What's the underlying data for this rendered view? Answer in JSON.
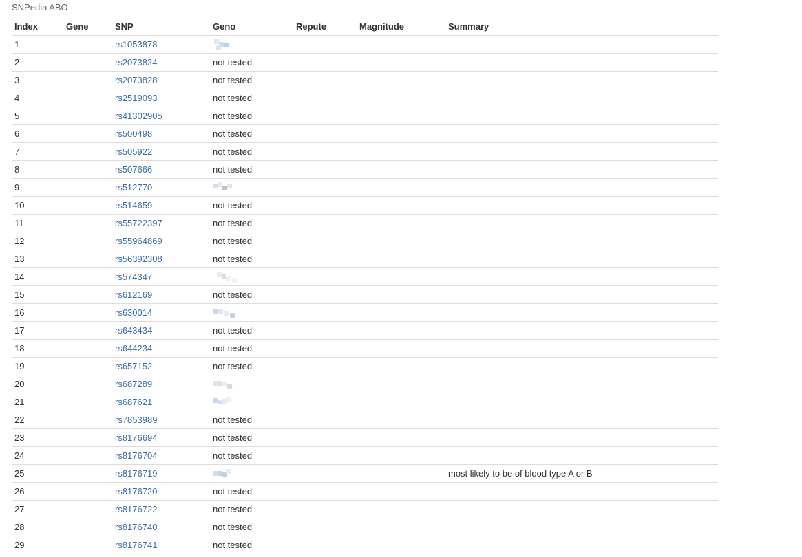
{
  "caption": "SNPedia ABO",
  "columns": [
    "Index",
    "Gene",
    "SNP",
    "Geno",
    "Repute",
    "Magnitude",
    "Summary"
  ],
  "rows": [
    {
      "index": "1",
      "gene": "",
      "snp": "rs1053878",
      "geno": "",
      "geno_blurred": true,
      "repute": "",
      "magnitude": "",
      "summary": ""
    },
    {
      "index": "2",
      "gene": "",
      "snp": "rs2073824",
      "geno": "not tested",
      "geno_blurred": false,
      "repute": "",
      "magnitude": "",
      "summary": ""
    },
    {
      "index": "3",
      "gene": "",
      "snp": "rs2073828",
      "geno": "not tested",
      "geno_blurred": false,
      "repute": "",
      "magnitude": "",
      "summary": ""
    },
    {
      "index": "4",
      "gene": "",
      "snp": "rs2519093",
      "geno": "not tested",
      "geno_blurred": false,
      "repute": "",
      "magnitude": "",
      "summary": ""
    },
    {
      "index": "5",
      "gene": "",
      "snp": "rs41302905",
      "geno": "not tested",
      "geno_blurred": false,
      "repute": "",
      "magnitude": "",
      "summary": ""
    },
    {
      "index": "6",
      "gene": "",
      "snp": "rs500498",
      "geno": "not tested",
      "geno_blurred": false,
      "repute": "",
      "magnitude": "",
      "summary": ""
    },
    {
      "index": "7",
      "gene": "",
      "snp": "rs505922",
      "geno": "not tested",
      "geno_blurred": false,
      "repute": "",
      "magnitude": "",
      "summary": ""
    },
    {
      "index": "8",
      "gene": "",
      "snp": "rs507666",
      "geno": "not tested",
      "geno_blurred": false,
      "repute": "",
      "magnitude": "",
      "summary": ""
    },
    {
      "index": "9",
      "gene": "",
      "snp": "rs512770",
      "geno": "",
      "geno_blurred": true,
      "repute": "",
      "magnitude": "",
      "summary": ""
    },
    {
      "index": "10",
      "gene": "",
      "snp": "rs514659",
      "geno": "not tested",
      "geno_blurred": false,
      "repute": "",
      "magnitude": "",
      "summary": ""
    },
    {
      "index": "11",
      "gene": "",
      "snp": "rs55722397",
      "geno": "not tested",
      "geno_blurred": false,
      "repute": "",
      "magnitude": "",
      "summary": ""
    },
    {
      "index": "12",
      "gene": "",
      "snp": "rs55964869",
      "geno": "not tested",
      "geno_blurred": false,
      "repute": "",
      "magnitude": "",
      "summary": ""
    },
    {
      "index": "13",
      "gene": "",
      "snp": "rs56392308",
      "geno": "not tested",
      "geno_blurred": false,
      "repute": "",
      "magnitude": "",
      "summary": ""
    },
    {
      "index": "14",
      "gene": "",
      "snp": "rs574347",
      "geno": "",
      "geno_blurred": true,
      "repute": "",
      "magnitude": "",
      "summary": ""
    },
    {
      "index": "15",
      "gene": "",
      "snp": "rs612169",
      "geno": "not tested",
      "geno_blurred": false,
      "repute": "",
      "magnitude": "",
      "summary": ""
    },
    {
      "index": "16",
      "gene": "",
      "snp": "rs630014",
      "geno": "",
      "geno_blurred": true,
      "repute": "",
      "magnitude": "",
      "summary": ""
    },
    {
      "index": "17",
      "gene": "",
      "snp": "rs643434",
      "geno": "not tested",
      "geno_blurred": false,
      "repute": "",
      "magnitude": "",
      "summary": ""
    },
    {
      "index": "18",
      "gene": "",
      "snp": "rs644234",
      "geno": "not tested",
      "geno_blurred": false,
      "repute": "",
      "magnitude": "",
      "summary": ""
    },
    {
      "index": "19",
      "gene": "",
      "snp": "rs657152",
      "geno": "not tested",
      "geno_blurred": false,
      "repute": "",
      "magnitude": "",
      "summary": ""
    },
    {
      "index": "20",
      "gene": "",
      "snp": "rs687289",
      "geno": "",
      "geno_blurred": true,
      "repute": "",
      "magnitude": "",
      "summary": ""
    },
    {
      "index": "21",
      "gene": "",
      "snp": "rs687621",
      "geno": "",
      "geno_blurred": true,
      "repute": "",
      "magnitude": "",
      "summary": ""
    },
    {
      "index": "22",
      "gene": "",
      "snp": "rs7853989",
      "geno": "not tested",
      "geno_blurred": false,
      "repute": "",
      "magnitude": "",
      "summary": ""
    },
    {
      "index": "23",
      "gene": "",
      "snp": "rs8176694",
      "geno": "not tested",
      "geno_blurred": false,
      "repute": "",
      "magnitude": "",
      "summary": ""
    },
    {
      "index": "24",
      "gene": "",
      "snp": "rs8176704",
      "geno": "not tested",
      "geno_blurred": false,
      "repute": "",
      "magnitude": "",
      "summary": ""
    },
    {
      "index": "25",
      "gene": "",
      "snp": "rs8176719",
      "geno": "",
      "geno_blurred": true,
      "repute": "",
      "magnitude": "",
      "summary": "most likely to be of blood type A or B"
    },
    {
      "index": "26",
      "gene": "",
      "snp": "rs8176720",
      "geno": "not tested",
      "geno_blurred": false,
      "repute": "",
      "magnitude": "",
      "summary": ""
    },
    {
      "index": "27",
      "gene": "",
      "snp": "rs8176722",
      "geno": "not tested",
      "geno_blurred": false,
      "repute": "",
      "magnitude": "",
      "summary": ""
    },
    {
      "index": "28",
      "gene": "",
      "snp": "rs8176740",
      "geno": "not tested",
      "geno_blurred": false,
      "repute": "",
      "magnitude": "",
      "summary": ""
    },
    {
      "index": "29",
      "gene": "",
      "snp": "rs8176741",
      "geno": "not tested",
      "geno_blurred": false,
      "repute": "",
      "magnitude": "",
      "summary": ""
    }
  ],
  "colors": {
    "link": "#3a6ea5",
    "text": "#333333",
    "caption": "#666666",
    "row_border": "#dddddd"
  }
}
